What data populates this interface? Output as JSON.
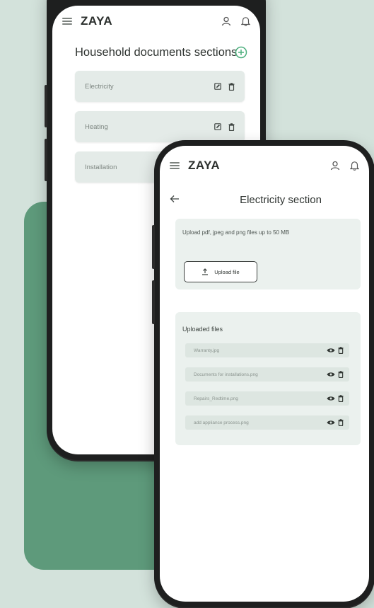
{
  "app": {
    "brand": "ZAYA"
  },
  "colors": {
    "background": "#d3e2db",
    "accent_green": "#5e9a7b",
    "add_icon": "#4caf7d"
  },
  "back_screen": {
    "title": "Household documents sections",
    "sections": [
      {
        "label": "Electricity"
      },
      {
        "label": "Heating"
      },
      {
        "label": "Installation"
      }
    ]
  },
  "front_screen": {
    "title": "Electricity section",
    "upload": {
      "instructions": "Upload pdf, jpeg and png files up to 50 MB",
      "button_label": "Upload file"
    },
    "uploaded": {
      "heading": "Uploaded files",
      "files": [
        {
          "name": "Warranty.jpg"
        },
        {
          "name": "Documents for installations.png"
        },
        {
          "name": "Repairs_Redtime.png"
        },
        {
          "name": "add appliance process.png"
        }
      ]
    }
  },
  "icons": [
    "menu-icon",
    "user-icon",
    "bell-icon",
    "add-circle-icon",
    "edit-icon",
    "trash-icon",
    "back-arrow-icon",
    "upload-icon",
    "eye-icon"
  ]
}
